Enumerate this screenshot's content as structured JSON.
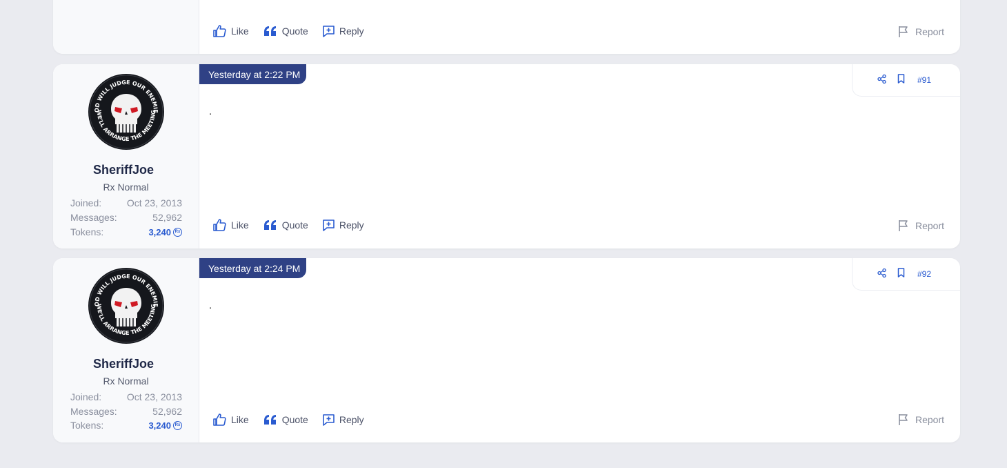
{
  "top_post": {
    "actions": {
      "like": "Like",
      "quote": "Quote",
      "reply": "Reply",
      "report": "Report"
    }
  },
  "posts": [
    {
      "date": "Yesterday at 2:22 PM",
      "number": "#91",
      "body": ".",
      "user": {
        "name": "SheriffJoe",
        "title": "Rx Normal",
        "joined_label": "Joined:",
        "joined": "Oct 23, 2013",
        "messages_label": "Messages:",
        "messages": "52,962",
        "tokens_label": "Tokens:",
        "tokens": "3,240",
        "avatar_ring_top": "GOD WILL JUDGE OUR ENEMIES",
        "avatar_ring_bottom": "WE'LL ARRANGE THE MEETING"
      },
      "actions": {
        "like": "Like",
        "quote": "Quote",
        "reply": "Reply",
        "report": "Report"
      }
    },
    {
      "date": "Yesterday at 2:24 PM",
      "number": "#92",
      "body": ".",
      "user": {
        "name": "SheriffJoe",
        "title": "Rx Normal",
        "joined_label": "Joined:",
        "joined": "Oct 23, 2013",
        "messages_label": "Messages:",
        "messages": "52,962",
        "tokens_label": "Tokens:",
        "tokens": "3,240",
        "avatar_ring_top": "GOD WILL JUDGE OUR ENEMIES",
        "avatar_ring_bottom": "WE'LL ARRANGE THE MEETING"
      },
      "actions": {
        "like": "Like",
        "quote": "Quote",
        "reply": "Reply",
        "report": "Report"
      }
    }
  ],
  "colors": {
    "accent": "#2a5bd0",
    "date_tab": "#2f4185",
    "background": "#eaebf0"
  },
  "icons": {
    "like": "thumbs-up-icon",
    "quote": "quote-icon",
    "reply": "reply-icon",
    "report": "flag-icon",
    "share": "share-icon",
    "bookmark": "bookmark-icon",
    "tokens": "rx-token-icon"
  }
}
